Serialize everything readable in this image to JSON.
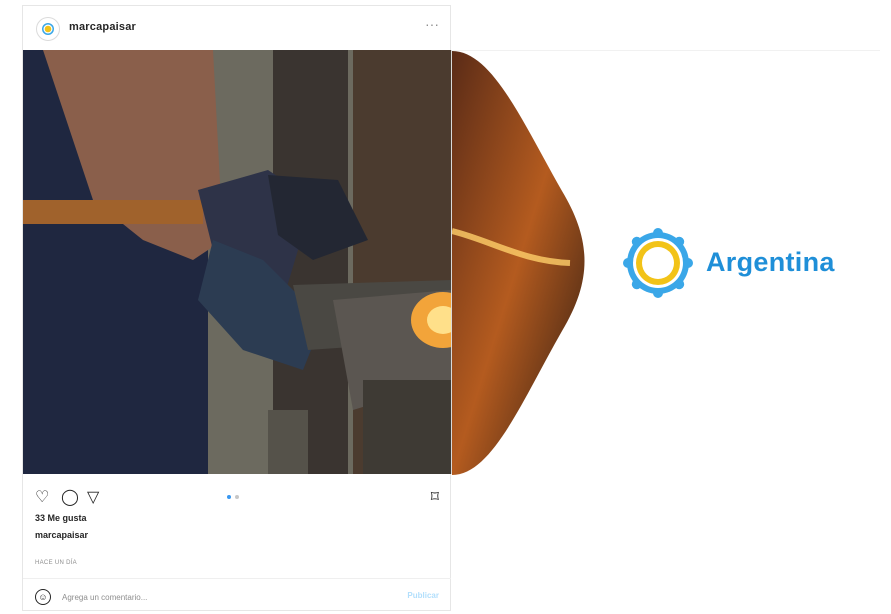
{
  "post": {
    "username": "marcapaisar",
    "more_icon": "more-icon",
    "likes": "33 Me gusta",
    "caption_user": "marcapaisar",
    "timestamp": "HACE UN DÍA",
    "comment_placeholder": "Agrega un comentario...",
    "publish_label": "Publicar",
    "carousel": {
      "slides": 2,
      "active": 1
    }
  },
  "brand": {
    "name": "Argentina",
    "name_color": "#1f8fd8",
    "sun_color": "#f2c318",
    "sun_ring_color": "#3aa7e8"
  },
  "colors": {
    "accent": "#3897f0",
    "publish_disabled": "#b2dffc"
  }
}
